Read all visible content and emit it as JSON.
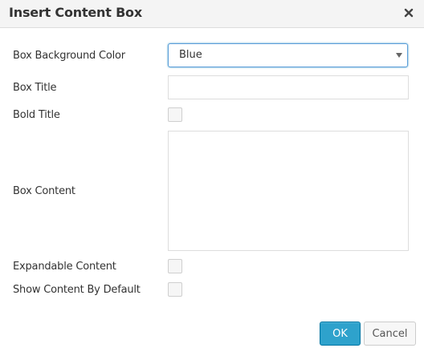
{
  "dialog": {
    "title": "Insert Content Box",
    "close_icon": "close-icon"
  },
  "form": {
    "bg_color_label": "Box Background Color",
    "bg_color_value": "Blue",
    "box_title_label": "Box Title",
    "box_title_value": "",
    "bold_title_label": "Bold Title",
    "bold_title_checked": false,
    "box_content_label": "Box Content",
    "box_content_value": "",
    "expandable_label": "Expandable Content",
    "expandable_checked": false,
    "show_default_label": "Show Content By Default",
    "show_default_checked": false
  },
  "buttons": {
    "ok_label": "OK",
    "cancel_label": "Cancel"
  },
  "colors": {
    "primary": "#2ea2cc",
    "focus_border": "#5b9dd9"
  }
}
